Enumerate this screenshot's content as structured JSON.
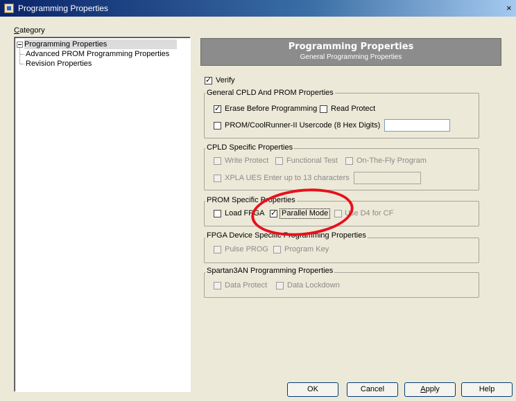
{
  "window": {
    "title": "Programming Properties",
    "close_glyph": "×"
  },
  "category": {
    "label_first": "C",
    "label_rest": "ategory"
  },
  "tree": {
    "items": [
      {
        "label": "Programming Properties"
      },
      {
        "label": "Advanced PROM Programming Properties"
      },
      {
        "label": "Revision Properties"
      }
    ]
  },
  "header": {
    "title": "Programming Properties",
    "subtitle": "General Programming Properties"
  },
  "verify": {
    "label": "Verify",
    "checked": true
  },
  "groups": {
    "general": {
      "title": "General CPLD And PROM Properties",
      "erase": "Erase Before Programming",
      "read_protect": "Read Protect",
      "usercode": "PROM/CoolRunner-II Usercode (8 Hex Digits)",
      "usercode_value": ""
    },
    "cpld": {
      "title": "CPLD Specific Properties",
      "write_protect": "Write Protect",
      "functional_test": "Functional Test",
      "on_the_fly": "On-The-Fly Program",
      "xpla_ues": "XPLA UES Enter up to 13 characters",
      "xpla_value": ""
    },
    "prom": {
      "title": "PROM Specific Properties",
      "load_fpga": "Load FPGA",
      "parallel_mode": "Parallel Mode",
      "use_d4": "Use D4 for CF"
    },
    "fpga": {
      "title": "FPGA Device Specific Programming Properties",
      "pulse_prog": "Pulse PROG",
      "program_key": "Program Key"
    },
    "spartan": {
      "title": "Spartan3AN Programming Properties",
      "data_protect": "Data Protect",
      "data_lockdown": "Data Lockdown"
    }
  },
  "buttons": {
    "ok": "OK",
    "cancel": "Cancel",
    "apply_first": "A",
    "apply_rest": "pply",
    "help": "Help"
  },
  "colors": {
    "annotation": "#e8101c",
    "title_bar": "#0a246a"
  }
}
